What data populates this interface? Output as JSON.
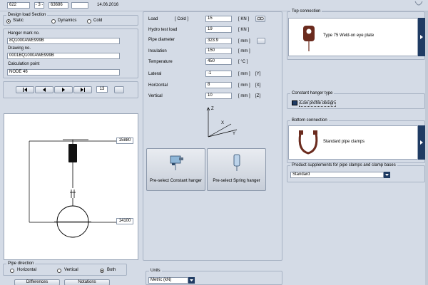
{
  "top_bar": {
    "field1": "622",
    "field2": "- 3 -",
    "field3": "63686",
    "field4": "",
    "date": "14.06.2016"
  },
  "design_load": {
    "title": "Design load Section",
    "options": [
      "Static",
      "Dynamics",
      "Cold"
    ],
    "selected": 0
  },
  "hanger_mark": {
    "label": "Hanger mark no.",
    "value": "8Q1000AWE999B"
  },
  "drawing_no": {
    "label": "Drawing no.",
    "value": "0001BQ1000AWE999B"
  },
  "calc_point": {
    "label": "Calculation point",
    "value": "NODE 46"
  },
  "navigator": {
    "page": "13"
  },
  "drawing": {
    "dim_top": "15880",
    "dim_bottom": "14100"
  },
  "loads": {
    "rows": [
      {
        "label": "Load",
        "sub": "[ Cold ]",
        "value": "15",
        "unit": "[ KN ]",
        "extra": ""
      },
      {
        "label": "Hydro test load",
        "sub": "",
        "value": "19",
        "unit": "[ KN ]",
        "extra": ""
      },
      {
        "label": "Pipe diameter",
        "sub": "",
        "value": "323.9",
        "unit": "[ mm ]",
        "extra": ""
      },
      {
        "label": "Insulation",
        "sub": "",
        "value": "150",
        "unit": "[ mm ]",
        "extra": ""
      },
      {
        "label": "Temperature",
        "sub": "",
        "value": "450",
        "unit": "[ °C ]",
        "extra": ""
      },
      {
        "label": "Lateral",
        "sub": "",
        "value": "-1",
        "unit": "[ mm ]",
        "extra": "[Y]"
      },
      {
        "label": "Horizontal",
        "sub": "",
        "value": "8",
        "unit": "[ mm ]",
        "extra": "[X]"
      },
      {
        "label": "Vertical",
        "sub": "",
        "value": "10",
        "unit": "[ mm ]",
        "extra": "[Z]"
      }
    ]
  },
  "axes": {
    "z": "Z",
    "x": "X",
    "y": "Y"
  },
  "preselect": {
    "constant": "Pre-select Constant hanger",
    "spring": "Pre-select Spring hanger"
  },
  "top_connection": {
    "title": "Top connection",
    "item": "Type 75 Weld-on eye plate"
  },
  "constant_hanger_type": {
    "title": "Constant hanger type",
    "option": "Low profile design"
  },
  "bottom_connection": {
    "title": "Bottom connection",
    "item": "Standard pipe clamps"
  },
  "product_supplements": {
    "title": "Product supplements for pipe clamps and clamp bases",
    "value": "Standard"
  },
  "pipe_direction": {
    "title": "Pipe direction",
    "options": [
      "Horizontal",
      "Vertical",
      "Both"
    ],
    "selected": 2
  },
  "units": {
    "title": "Units",
    "value": "Metric (kN)"
  },
  "bottom_buttons": {
    "differences": "Differences",
    "notations": "Notations"
  },
  "colors": {
    "background": "#d4dbe6",
    "accent": "#1f3b63",
    "hanger_brown": "#6b2b1e"
  }
}
